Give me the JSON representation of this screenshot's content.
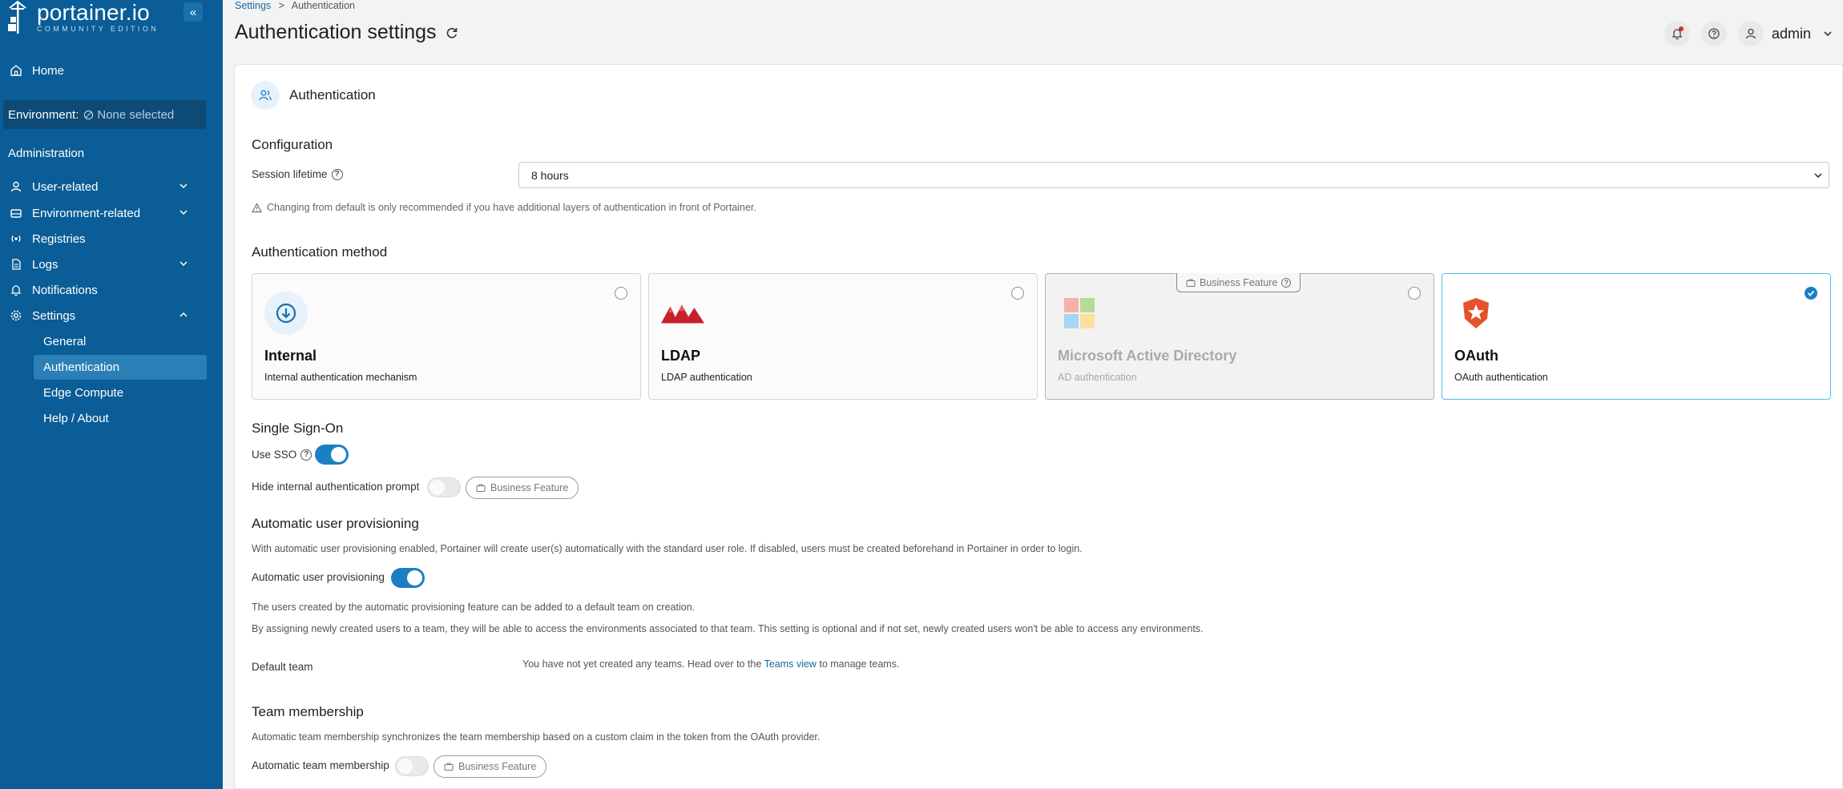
{
  "app": {
    "logo_main": "portainer.io",
    "logo_sub": "COMMUNITY EDITION",
    "collapse_icon": "chevrons-left-icon"
  },
  "sidebar": {
    "home": "Home",
    "environment_label": "Environment:",
    "environment_value": "None selected",
    "section": "Administration",
    "items": [
      {
        "label": "User-related",
        "icon": "user-icon",
        "expandable": true
      },
      {
        "label": "Environment-related",
        "icon": "hdd-icon",
        "expandable": true
      },
      {
        "label": "Registries",
        "icon": "radio-icon",
        "expandable": false
      },
      {
        "label": "Logs",
        "icon": "file-icon",
        "expandable": true
      },
      {
        "label": "Notifications",
        "icon": "bell-icon",
        "expandable": false
      },
      {
        "label": "Settings",
        "icon": "gear-icon",
        "expandable": true
      }
    ],
    "settings_sub": [
      "General",
      "Authentication",
      "Edge Compute",
      "Help / About"
    ],
    "active_sub": "Authentication"
  },
  "header": {
    "breadcrumb_root": "Settings",
    "breadcrumb_sep": ">",
    "breadcrumb_current": "Authentication",
    "title": "Authentication settings",
    "user": "admin"
  },
  "card": {
    "title": "Authentication",
    "configuration": {
      "heading": "Configuration",
      "session_label": "Session lifetime",
      "session_value": "8 hours",
      "warning": "Changing from default is only recommended if you have additional layers of authentication in front of Portainer."
    },
    "method": {
      "heading": "Authentication method",
      "options": [
        {
          "title": "Internal",
          "subtitle": "Internal authentication mechanism",
          "selected": false,
          "disabled": false
        },
        {
          "title": "LDAP",
          "subtitle": "LDAP authentication",
          "selected": false,
          "disabled": false
        },
        {
          "title": "Microsoft Active Directory",
          "subtitle": "AD authentication",
          "selected": false,
          "disabled": true,
          "badge": "Business Feature"
        },
        {
          "title": "OAuth",
          "subtitle": "OAuth authentication",
          "selected": true,
          "disabled": false
        }
      ]
    },
    "sso": {
      "heading": "Single Sign-On",
      "use_sso": "Use SSO",
      "use_sso_on": true,
      "hide_prompt": "Hide internal authentication prompt",
      "hide_prompt_on": false,
      "badge": "Business Feature"
    },
    "provisioning": {
      "heading": "Automatic user provisioning",
      "desc": "With automatic user provisioning enabled, Portainer will create user(s) automatically with the standard user role. If disabled, users must be created beforehand in Portainer in order to login.",
      "toggle_label": "Automatic user provisioning",
      "toggle_on": true,
      "note1": "The users created by the automatic provisioning feature can be added to a default team on creation.",
      "note2": "By assigning newly created users to a team, they will be able to access the environments associated to that team. This setting is optional and if not set, newly created users won't be able to access any environments.",
      "default_team_label": "Default team",
      "default_team_pre": "You have not yet created any teams. Head over to the",
      "default_team_link": "Teams view",
      "default_team_post": "to manage teams."
    },
    "team_membership": {
      "heading": "Team membership",
      "desc": "Automatic team membership synchronizes the team membership based on a custom claim in the token from the OAuth provider.",
      "toggle_label": "Automatic team membership",
      "toggle_on": false,
      "badge": "Business Feature"
    }
  },
  "colors": {
    "sidebar_bg": "#0a5d96",
    "accent": "#1b7fc4",
    "selected_border": "#4fc1ea"
  }
}
